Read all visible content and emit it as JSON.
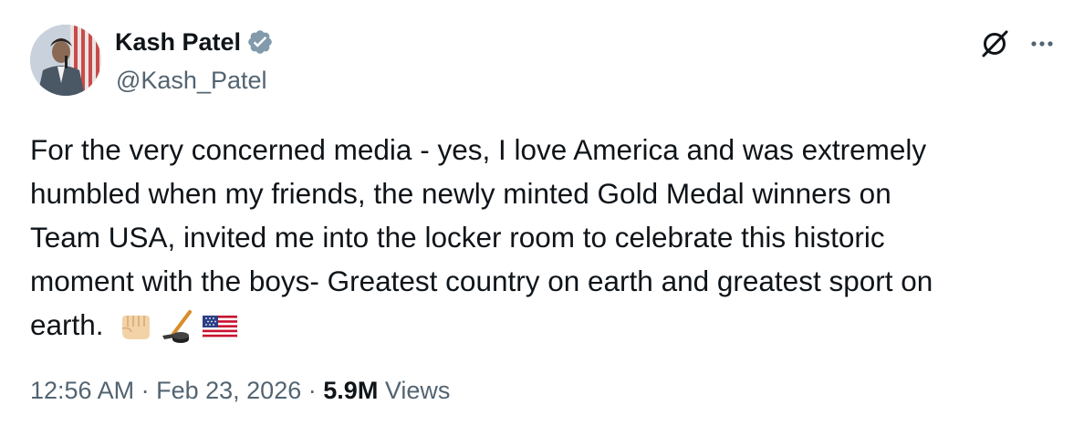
{
  "author": {
    "display_name": "Kash Patel",
    "handle": "@Kash_Patel",
    "verified": true
  },
  "tweet": {
    "text_lines": [
      "For the very concerned media - yes, I love America and was extremely",
      "humbled when my friends, the newly minted Gold Medal winners on",
      "Team USA, invited me into the locker room to celebrate this historic",
      "moment with the boys- Greatest country on earth and greatest sport on",
      "earth."
    ],
    "emojis": [
      "fist-emoji",
      "hockey-stick-puck-emoji",
      "us-flag-emoji"
    ]
  },
  "meta": {
    "time": "12:56 AM",
    "separator": "·",
    "date": "Feb 23, 2026",
    "views_count": "5.9M",
    "views_label": "Views"
  },
  "icons": {
    "verified": "verified-badge-icon",
    "grok": "grok-icon",
    "more": "more-options-icon"
  },
  "colors": {
    "text_primary": "#0f1419",
    "text_secondary": "#536471",
    "verified_badge": "#829aab"
  }
}
